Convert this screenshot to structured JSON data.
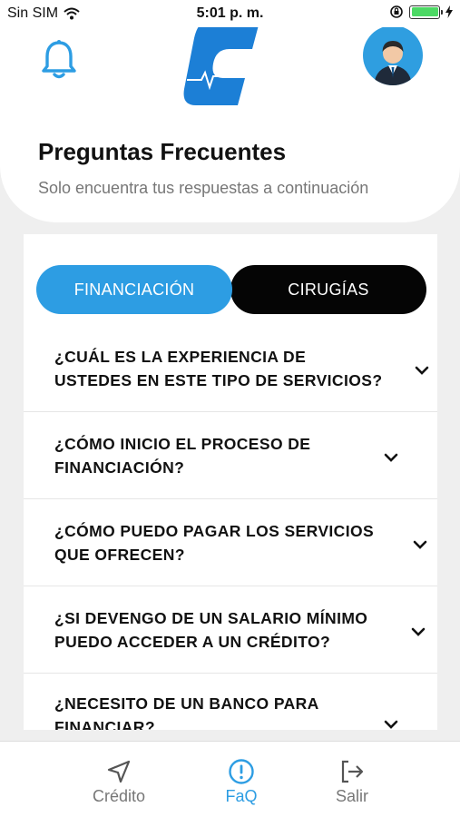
{
  "status_bar": {
    "carrier": "Sin SIM",
    "time": "5:01 p. m."
  },
  "header": {
    "title": "Preguntas Frecuentes",
    "subtitle": "Solo encuentra tus respuestas a continuación"
  },
  "tabs": [
    {
      "label": "FINANCIACIÓN",
      "active": true
    },
    {
      "label": "CIRUGÍAS",
      "active": false
    }
  ],
  "faq": [
    {
      "question": "¿CUÁL ES LA EXPERIENCIA DE USTEDES EN ESTE TIPO DE SERVICIOS?"
    },
    {
      "question": "¿CÓMO INICIO EL  PROCESO DE FINANCIACIÓN?"
    },
    {
      "question": "¿CÓMO PUEDO PAGAR LOS SERVICIOS QUE OFRECEN?"
    },
    {
      "question": "¿SI DEVENGO DE UN SALARIO MÍNIMO PUEDO ACCEDER A UN CRÉDITO?"
    },
    {
      "question": "¿NECESITO DE UN BANCO PARA FINANCIAR?"
    }
  ],
  "bottom_nav": [
    {
      "label": "Crédito",
      "icon": "navigation-arrow-icon"
    },
    {
      "label": "FaQ",
      "icon": "exclamation-circle-icon",
      "active": true
    },
    {
      "label": "Salir",
      "icon": "logout-icon"
    }
  ],
  "colors": {
    "accent": "#2d9de3",
    "inactive_tab": "#050505",
    "background": "#efefef"
  }
}
